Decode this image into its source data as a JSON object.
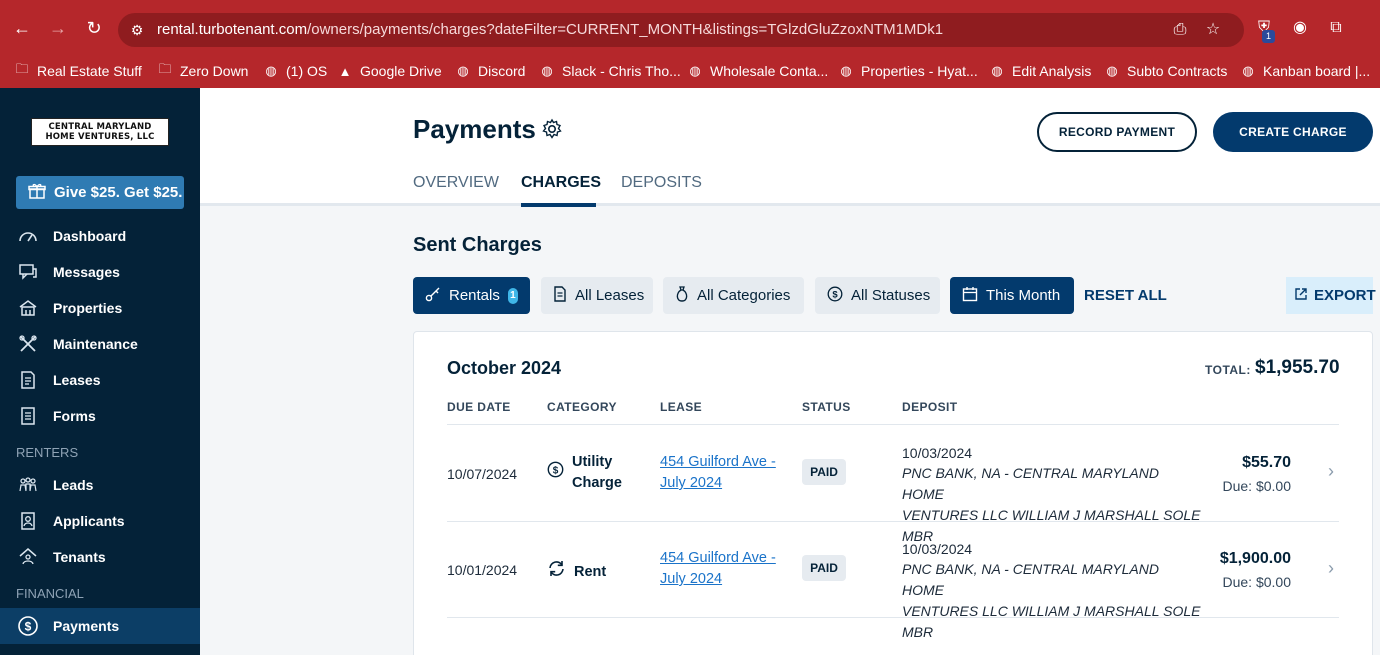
{
  "browser": {
    "url_host": "rental.turbotenant.com",
    "url_path": "/owners/payments/charges?dateFilter=CURRENT_MONTH&listings=TGlzdGluZzoxNTM1MDk1",
    "extension_badge": "1",
    "bookmarks": [
      {
        "label": "Real Estate Stuff",
        "icon": "folder-icon"
      },
      {
        "label": "Zero Down",
        "icon": "folder-icon"
      },
      {
        "label": "(1) OS",
        "icon": "globe-icon"
      },
      {
        "label": "Google Drive",
        "icon": "drive-icon"
      },
      {
        "label": "Discord",
        "icon": "globe-icon"
      },
      {
        "label": "Slack - Chris Tho...",
        "icon": "globe-icon"
      },
      {
        "label": "Wholesale Conta...",
        "icon": "globe-icon"
      },
      {
        "label": "Properties - Hyat...",
        "icon": "globe-icon"
      },
      {
        "label": "Edit Analysis",
        "icon": "globe-icon"
      },
      {
        "label": "Subto Contracts",
        "icon": "globe-icon"
      },
      {
        "label": "Kanban board |...",
        "icon": "globe-icon"
      }
    ]
  },
  "sidebar": {
    "logo_line1": "CENTRAL MARYLAND",
    "logo_line2": "HOME VENTURES, LLC",
    "promo": "Give $25. Get $25.",
    "items": [
      {
        "label": "Dashboard",
        "icon": "dashboard-icon"
      },
      {
        "label": "Messages",
        "icon": "messages-icon"
      },
      {
        "label": "Properties",
        "icon": "properties-icon"
      },
      {
        "label": "Maintenance",
        "icon": "maintenance-icon"
      },
      {
        "label": "Leases",
        "icon": "leases-icon"
      },
      {
        "label": "Forms",
        "icon": "forms-icon"
      }
    ],
    "renters_label": "RENTERS",
    "renters_items": [
      {
        "label": "Leads",
        "icon": "leads-icon"
      },
      {
        "label": "Applicants",
        "icon": "applicants-icon"
      },
      {
        "label": "Tenants",
        "icon": "tenants-icon"
      }
    ],
    "financial_label": "FINANCIAL",
    "financial_items": [
      {
        "label": "Payments",
        "icon": "payments-icon",
        "active": true
      }
    ]
  },
  "header": {
    "title": "Payments",
    "record_payment": "RECORD PAYMENT",
    "create_charge": "CREATE CHARGE",
    "tabs": [
      {
        "label": "OVERVIEW",
        "active": false
      },
      {
        "label": "CHARGES",
        "active": true
      },
      {
        "label": "DEPOSITS",
        "active": false
      }
    ]
  },
  "charges": {
    "section_title": "Sent Charges",
    "filters": {
      "rentals": "Rentals",
      "rentals_count": "1",
      "leases": "All Leases",
      "categories": "All Categories",
      "statuses": "All Statuses",
      "date": "This Month",
      "reset": "RESET ALL",
      "export": "EXPORT"
    },
    "month": "October 2024",
    "total_label": "TOTAL:",
    "total_value": "$1,955.70",
    "columns": [
      "DUE DATE",
      "CATEGORY",
      "LEASE",
      "STATUS",
      "DEPOSIT"
    ],
    "rows": [
      {
        "due_date": "10/07/2024",
        "category_line1": "Utility",
        "category_line2": "Charge",
        "category_icon": "dollar-circle-icon",
        "lease_line1": "454 Guilford Ave -",
        "lease_line2": "July 2024",
        "status": "PAID",
        "deposit_date": "10/03/2024",
        "deposit_line1": "PNC BANK, NA - CENTRAL MARYLAND HOME",
        "deposit_line2": "VENTURES LLC WILLIAM J MARSHALL SOLE MBR",
        "amount": "$55.70",
        "due": "Due: $0.00"
      },
      {
        "due_date": "10/01/2024",
        "category_line1": "Rent",
        "category_line2": "",
        "category_icon": "recurring-icon",
        "lease_line1": "454 Guilford Ave -",
        "lease_line2": "July 2024",
        "status": "PAID",
        "deposit_date": "10/03/2024",
        "deposit_line1": "PNC BANK, NA - CENTRAL MARYLAND HOME",
        "deposit_line2": "VENTURES LLC WILLIAM J MARSHALL SOLE MBR",
        "amount": "$1,900.00",
        "due": "Due: $0.00"
      }
    ]
  },
  "colors": {
    "chrome": "#b5272b",
    "sidebar": "#042238",
    "primary": "#033a6d",
    "link": "#1a73c9"
  }
}
